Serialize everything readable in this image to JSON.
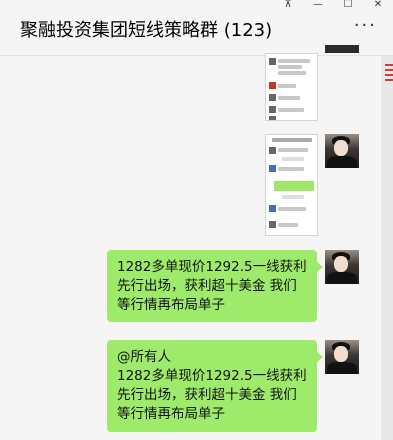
{
  "window": {
    "title": "聚融投资集团短线策略群 (123)",
    "controls": [
      "pin",
      "minimize",
      "maximize",
      "close"
    ]
  },
  "header": {
    "more_label": "···"
  },
  "messages": [
    {
      "type": "image",
      "sender": "self"
    },
    {
      "type": "image",
      "sender": "self"
    },
    {
      "type": "text",
      "sender": "self",
      "text": "1282多单现价1292.5一线获利\n先行出场，获利超十美金  我们\n等行情再布局单子"
    },
    {
      "type": "text",
      "sender": "self",
      "text": "@所有人\n1282多单现价1292.5一线获利\n先行出场，获利超十美金  我们\n等行情再布局单子"
    }
  ],
  "colors": {
    "bubble": "#9eea6a",
    "background": "#f5f5f5"
  }
}
